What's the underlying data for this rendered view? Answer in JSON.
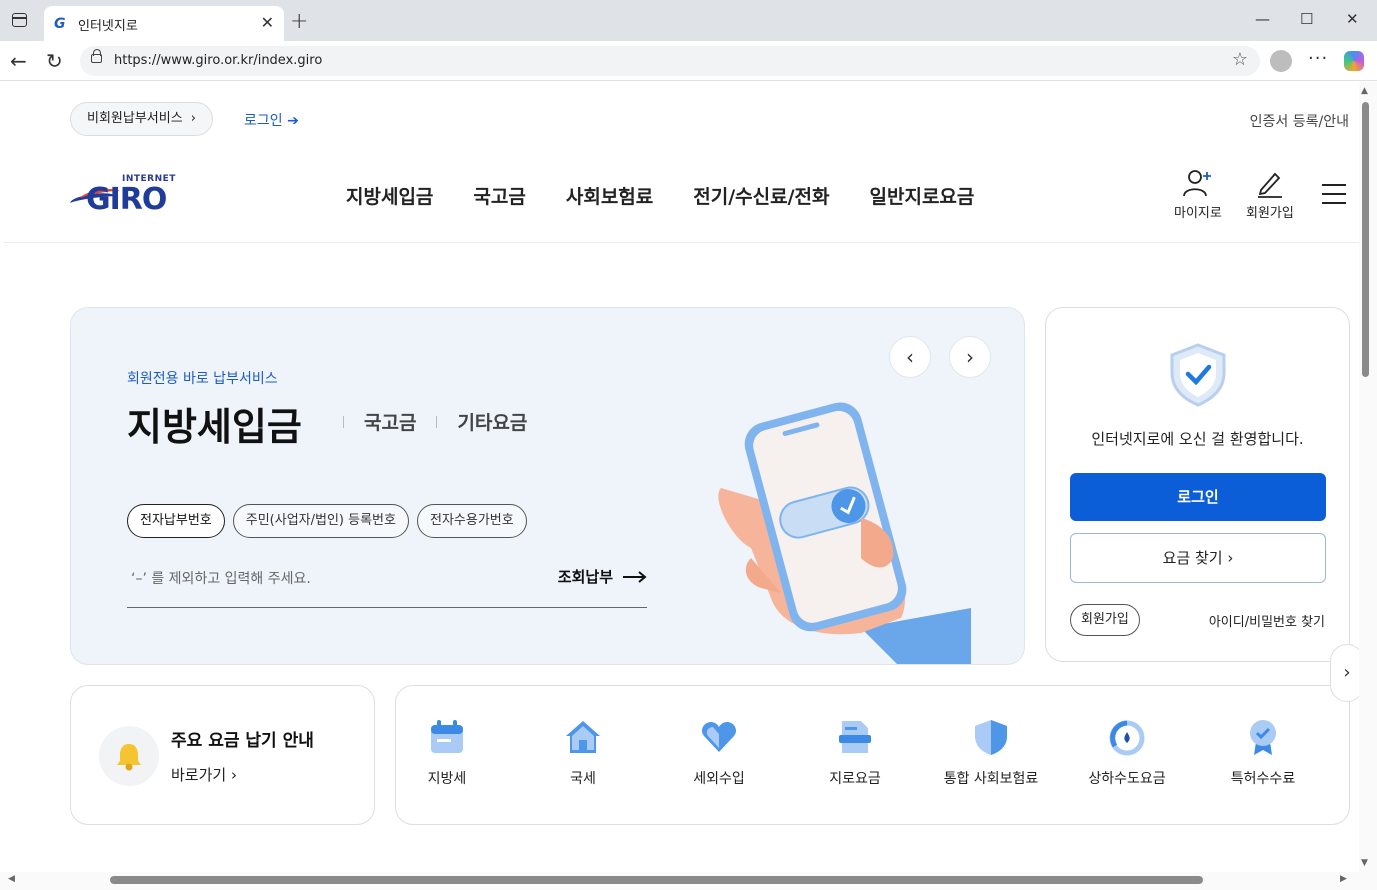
{
  "browser": {
    "tab_title": "인터넷지로",
    "url": "https://www.giro.or.kr/index.giro"
  },
  "top": {
    "guest_service": "비회원납부서비스",
    "login": "로그인",
    "cert": "인증서 등록/안내"
  },
  "logo": {
    "small": "INTERNET",
    "big": "GIRO"
  },
  "gnb": [
    "지방세입금",
    "국고금",
    "사회보험료",
    "전기/수신료/전화",
    "일반지로요금"
  ],
  "util": {
    "mygiro": "마이지로",
    "join": "회원가입"
  },
  "hero": {
    "eyebrow": "회원전용 바로 납부서비스",
    "title": "지방세입금",
    "sub_tabs": [
      "국고금",
      "기타요금"
    ],
    "chips": [
      "전자납부번호",
      "주민(사업자/법인) 등록번호",
      "전자수용가번호"
    ],
    "placeholder": "‘–’ 를 제외하고 입력해 주세요.",
    "go": "조회납부"
  },
  "login_box": {
    "welcome": "인터넷지로에 오신 걸 환영합니다.",
    "login_btn": "로그인",
    "fee_btn": "요금 찾기",
    "join": "회원가입",
    "find": "아이디/비밀번호 찾기"
  },
  "guide": {
    "title": "주요 요금 납기 안내",
    "link": "바로가기"
  },
  "services": [
    "지방세",
    "국세",
    "세외수입",
    "지로요금",
    "통합 사회보험료",
    "상하수도요금",
    "특허수수료"
  ],
  "colors": {
    "primary": "#0b5ed7",
    "accent_blue": "#1d5cc8",
    "hero_bg": "#eef4fa"
  }
}
